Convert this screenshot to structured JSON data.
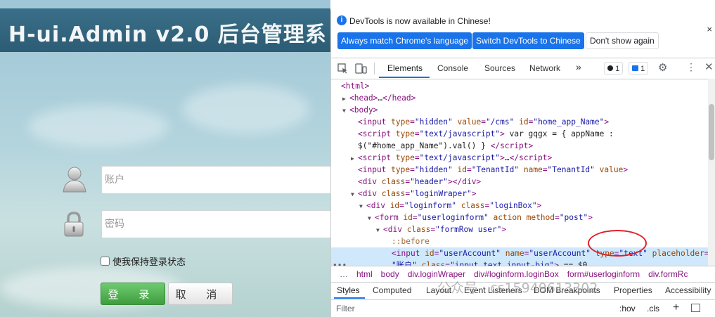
{
  "login": {
    "title": "H-ui.Admin v2.0 后台管理系",
    "account_placeholder": "账户",
    "password_placeholder": "密码",
    "remember_label": "使我保持登录状态",
    "login_button": "登 录",
    "cancel_button": "取 消"
  },
  "devtools": {
    "infobar": {
      "message": "DevTools is now available in Chinese!",
      "btn_match": "Always match Chrome's language",
      "btn_switch": "Switch DevTools to Chinese",
      "btn_dismiss": "Don't show again",
      "close": "×"
    },
    "tabs": [
      "Elements",
      "Console",
      "Sources",
      "Network",
      "»"
    ],
    "badges": {
      "errors": "1",
      "messages": "1"
    },
    "tree": [
      {
        "indent": 0,
        "tri": "",
        "html": "<span class='tag'>&lt;html&gt;</span>"
      },
      {
        "indent": 1,
        "tri": "▶",
        "html": "<span class='tag'>&lt;head&gt;</span><span class='tx'>…</span><span class='tag'>&lt;/head&gt;</span>"
      },
      {
        "indent": 1,
        "tri": "▼",
        "html": "<span class='tag'>&lt;body&gt;</span>"
      },
      {
        "indent": 2,
        "tri": "",
        "html": "<span class='tag'>&lt;input </span><span class='an'>type</span><span class='tag'>=</span><span class='av'>\"hidden\"</span> <span class='an'>value</span><span class='tag'>=</span><span class='av'>\"/cms\"</span> <span class='an'>id</span><span class='tag'>=</span><span class='av'>\"home_app_Name\"</span><span class='tag'>&gt;</span>"
      },
      {
        "indent": 2,
        "tri": "",
        "html": "<span class='tag'>&lt;script </span><span class='an'>type</span><span class='tag'>=</span><span class='av'>\"text/javascript\"</span><span class='tag'>&gt;</span><span class='tx'> var gqgx = { appName :</span>"
      },
      {
        "indent": 2,
        "tri": "",
        "html": "<span class='tx'>$(\"#home_app_Name\").val() } </span><span class='tag'>&lt;/script&gt;</span>"
      },
      {
        "indent": 2,
        "tri": "▶",
        "html": "<span class='tag'>&lt;script </span><span class='an'>type</span><span class='tag'>=</span><span class='av'>\"text/javascript\"</span><span class='tag'>&gt;</span><span class='tx'>…</span><span class='tag'>&lt;/script&gt;</span>"
      },
      {
        "indent": 2,
        "tri": "",
        "html": "<span class='tag'>&lt;input </span><span class='an'>type</span><span class='tag'>=</span><span class='av'>\"hidden\"</span> <span class='an'>id</span><span class='tag'>=</span><span class='av'>\"TenantId\"</span> <span class='an'>name</span><span class='tag'>=</span><span class='av'>\"TenantId\"</span> <span class='an'>value</span><span class='tag'>&gt;</span>"
      },
      {
        "indent": 2,
        "tri": "",
        "html": "<span class='tag'>&lt;div </span><span class='an'>class</span><span class='tag'>=</span><span class='av'>\"header\"</span><span class='tag'>&gt;&lt;/div&gt;</span>"
      },
      {
        "indent": 2,
        "tri": "▼",
        "html": "<span class='tag'>&lt;div </span><span class='an'>class</span><span class='tag'>=</span><span class='av'>\"loginWraper\"</span><span class='tag'>&gt;</span>"
      },
      {
        "indent": 3,
        "tri": "▼",
        "html": "<span class='tag'>&lt;div </span><span class='an'>id</span><span class='tag'>=</span><span class='av'>\"loginform\"</span> <span class='an'>class</span><span class='tag'>=</span><span class='av'>\"loginBox\"</span><span class='tag'>&gt;</span>"
      },
      {
        "indent": 4,
        "tri": "▼",
        "html": "<span class='tag'>&lt;form </span><span class='an'>id</span><span class='tag'>=</span><span class='av'>\"userloginform\"</span> <span class='an'>action method</span><span class='tag'>=</span><span class='av'>\"post\"</span><span class='tag'>&gt;</span>"
      },
      {
        "indent": 5,
        "tri": "▼",
        "html": "<span class='tag'>&lt;div </span><span class='an'>class</span><span class='tag'>=</span><span class='av'>\"formRow user\"</span><span class='tag'>&gt;</span>"
      },
      {
        "indent": 6,
        "tri": "",
        "html": "<span class='ps'>::before</span>"
      },
      {
        "indent": 6,
        "tri": "",
        "sel": true,
        "html": "<span class='tag'>&lt;input </span><span class='an'>id</span><span class='tag'>=</span><span class='av'>\"userAccount\"</span> <span class='an'>name</span><span class='tag'>=</span><span class='av'>\"userAccount\"</span> <span class='an'>type</span><span class='tag'>=</span><span class='av'>\"text\"</span> <span class='an'>placeholder</span><span class='tag'>=</span>"
      },
      {
        "indent": 6,
        "tri": "",
        "sel": true,
        "html": "<span class='av'>\"账户\"</span> <span class='an'>class</span><span class='tag'>=</span><span class='av'>\"input_text input-big\"</span><span class='tag'>&gt;</span><span class='tx'> == $0</span>"
      }
    ],
    "breadcrumbs": [
      "…",
      "html",
      "body",
      "div.loginWraper",
      "div#loginform.loginBox",
      "form#userloginform",
      "div.formRc"
    ],
    "subtabs": [
      "Styles",
      "Computed",
      "Layout",
      "Event Listeners",
      "DOM Breakpoints",
      "Properties",
      "Accessibility"
    ],
    "filter_placeholder": "Filter",
    "filter_tools": [
      ":hov",
      ".cls",
      "+"
    ]
  },
  "watermark": "公众号 · cs15949613302"
}
